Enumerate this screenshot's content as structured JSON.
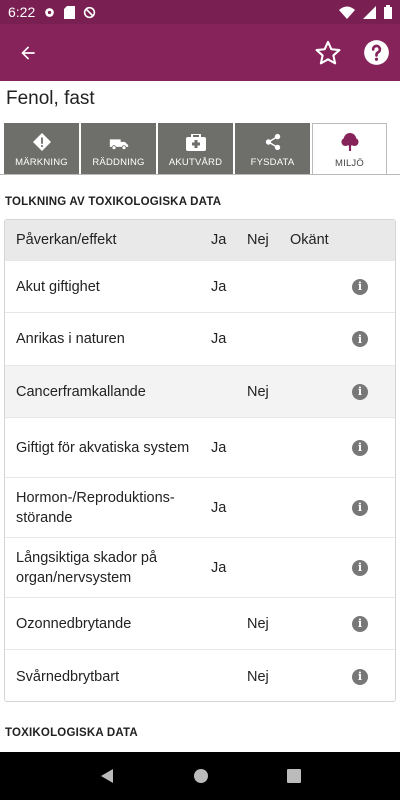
{
  "status": {
    "time": "6:22"
  },
  "title": "Fenol, fast",
  "tabs": [
    {
      "label": "MÄRKNING",
      "icon": "warning-icon"
    },
    {
      "label": "RÄDDNING",
      "icon": "truck-icon"
    },
    {
      "label": "AKUTVÅRD",
      "icon": "first-aid-icon"
    },
    {
      "label": "FYSDATA",
      "icon": "share-icon"
    },
    {
      "label": "MILJÖ",
      "icon": "tree-icon",
      "active": true
    }
  ],
  "section1": "TOLKNING AV TOXIKOLOGISKA DATA",
  "table": {
    "headers": {
      "effect": "Påverkan/effekt",
      "yes": "Ja",
      "no": "Nej",
      "unknown": "Okänt"
    },
    "rows": [
      {
        "name": "Akut giftighet",
        "yes": "Ja",
        "no": ""
      },
      {
        "name": "Anrikas i naturen",
        "yes": "Ja",
        "no": ""
      },
      {
        "name": "Cancerframkallande",
        "yes": "",
        "no": "Nej"
      },
      {
        "name": "Giftigt för akvatiska system",
        "yes": "Ja",
        "no": ""
      },
      {
        "name": "Hormon-/Reproduktions-störande",
        "yes": "Ja",
        "no": ""
      },
      {
        "name": "Långsiktiga skador på organ/nervsystem",
        "yes": "Ja",
        "no": ""
      },
      {
        "name": "Ozonnedbrytande",
        "yes": "",
        "no": "Nej"
      },
      {
        "name": "Svårnedbrytbart",
        "yes": "",
        "no": "Nej"
      }
    ]
  },
  "section2": "TOXIKOLOGISKA DATA",
  "colors": {
    "primary": "#85235a",
    "statusbar": "#7a1f52",
    "tab": "#6e6e6a",
    "accent_icon": "#85235a"
  }
}
